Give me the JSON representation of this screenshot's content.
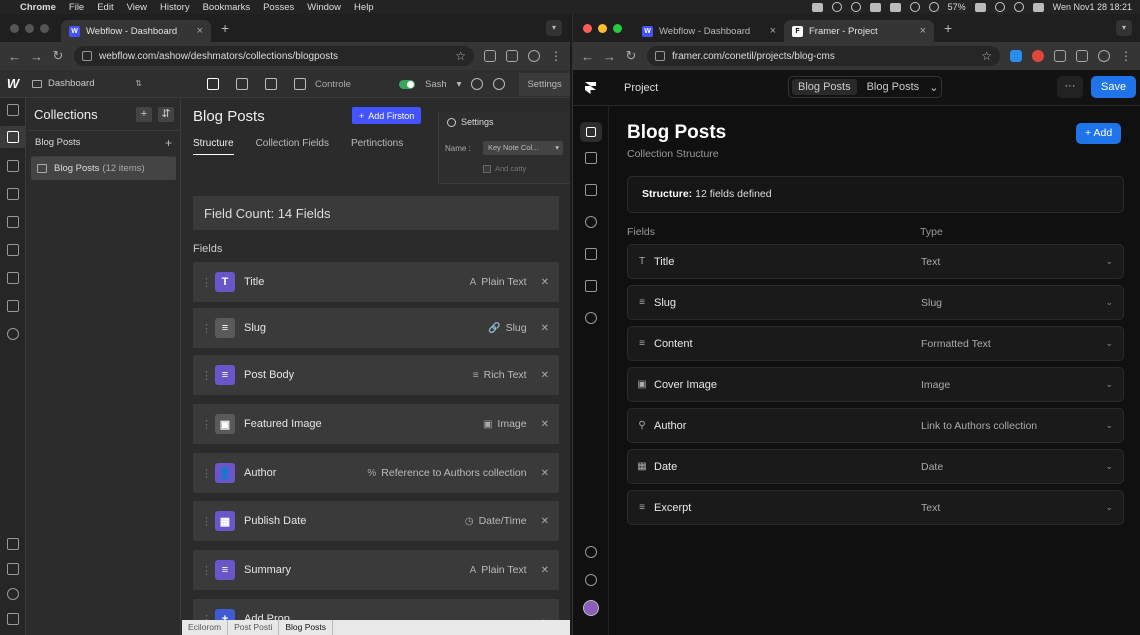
{
  "menubar": {
    "app": "Chrome",
    "items": [
      "File",
      "Edit",
      "View",
      "History",
      "Bookmarks",
      "Posses",
      "Window",
      "Help"
    ],
    "battery": "57%",
    "clock": "Wen Nov1 28  18:21"
  },
  "left_window": {
    "tab_title": "Webflow - Dashboard",
    "url": "webflow.com/ashow/deshmators/collections/blogposts",
    "toolbar": {
      "dashboard": "Dashboard",
      "controls_label": "Controle",
      "mode_label": "Sash",
      "settings_label": "Settings"
    },
    "collections": {
      "title": "Collections",
      "items": [
        {
          "label": "Blog Posts",
          "count": ""
        },
        {
          "label": "Blog Posts",
          "count": "(12 items)"
        }
      ]
    },
    "main": {
      "title": "Blog Posts",
      "add_button": "Add Firston",
      "tabs": [
        "Structure",
        "Collection Fields",
        "Pertinctions"
      ],
      "field_count": "Field Count: 14 Fields",
      "fields_label": "Fields",
      "fields": [
        {
          "name": "Title",
          "type": "Plain Text",
          "badge": "T",
          "type_icon": "A"
        },
        {
          "name": "Slug",
          "type": "Slug",
          "badge": "≡",
          "type_icon": "🔗"
        },
        {
          "name": "Post Body",
          "type": "Rich Text",
          "badge": "≡",
          "type_icon": "≡"
        },
        {
          "name": "Featured Image",
          "type": "Image",
          "badge": "▣",
          "type_icon": "▣"
        },
        {
          "name": "Author",
          "type": "Reference to Authors collection",
          "badge": "👤",
          "type_icon": "%"
        },
        {
          "name": "Publish Date",
          "type": "Date/Time",
          "badge": "▦",
          "type_icon": "◷"
        },
        {
          "name": "Summary",
          "type": "Plain Text",
          "badge": "≡",
          "type_icon": "A"
        }
      ],
      "add_prop": "Add Prop"
    },
    "settings_popover": {
      "title": "Settings",
      "name_label": "Name :",
      "name_value": "Key Note Col...",
      "checkbox_label": "And catty"
    },
    "breadcrumbs": [
      "Ecilorom",
      "Post Posti",
      "Blog Posts"
    ]
  },
  "right_window": {
    "tab_title": "Webflow - Dashboard",
    "tab2_title": "Framer - Project",
    "url": "framer.com/conetil/projects/blog-cms",
    "header": {
      "project": "Project",
      "seg_items": [
        "Blog Posts",
        "Blog Posts"
      ],
      "more": "···",
      "save": "Save"
    },
    "main": {
      "title": "Blog Posts",
      "subtitle": "Collection Structure",
      "add_button": "+ Add",
      "structure_label": "Structure:",
      "structure_text": "12 fields defined",
      "col_fields": "Fields",
      "col_type": "Type",
      "rows": [
        {
          "icon": "T",
          "name": "Title",
          "type": "Text"
        },
        {
          "icon": "≡",
          "name": "Slug",
          "type": "Slug"
        },
        {
          "icon": "≡",
          "name": "Content",
          "type": "Formatted Text"
        },
        {
          "icon": "▣",
          "name": "Cover Image",
          "type": "Image"
        },
        {
          "icon": "⚲",
          "name": "Author",
          "type": "Link to Authors collection"
        },
        {
          "icon": "▦",
          "name": "Date",
          "type": "Date"
        },
        {
          "icon": "≡",
          "name": "Excerpt",
          "type": "Text"
        }
      ]
    }
  },
  "colors": {
    "webflow_accent": "#4353ff",
    "framer_accent": "#1e74e8",
    "field_badge": "#6a56c9"
  }
}
